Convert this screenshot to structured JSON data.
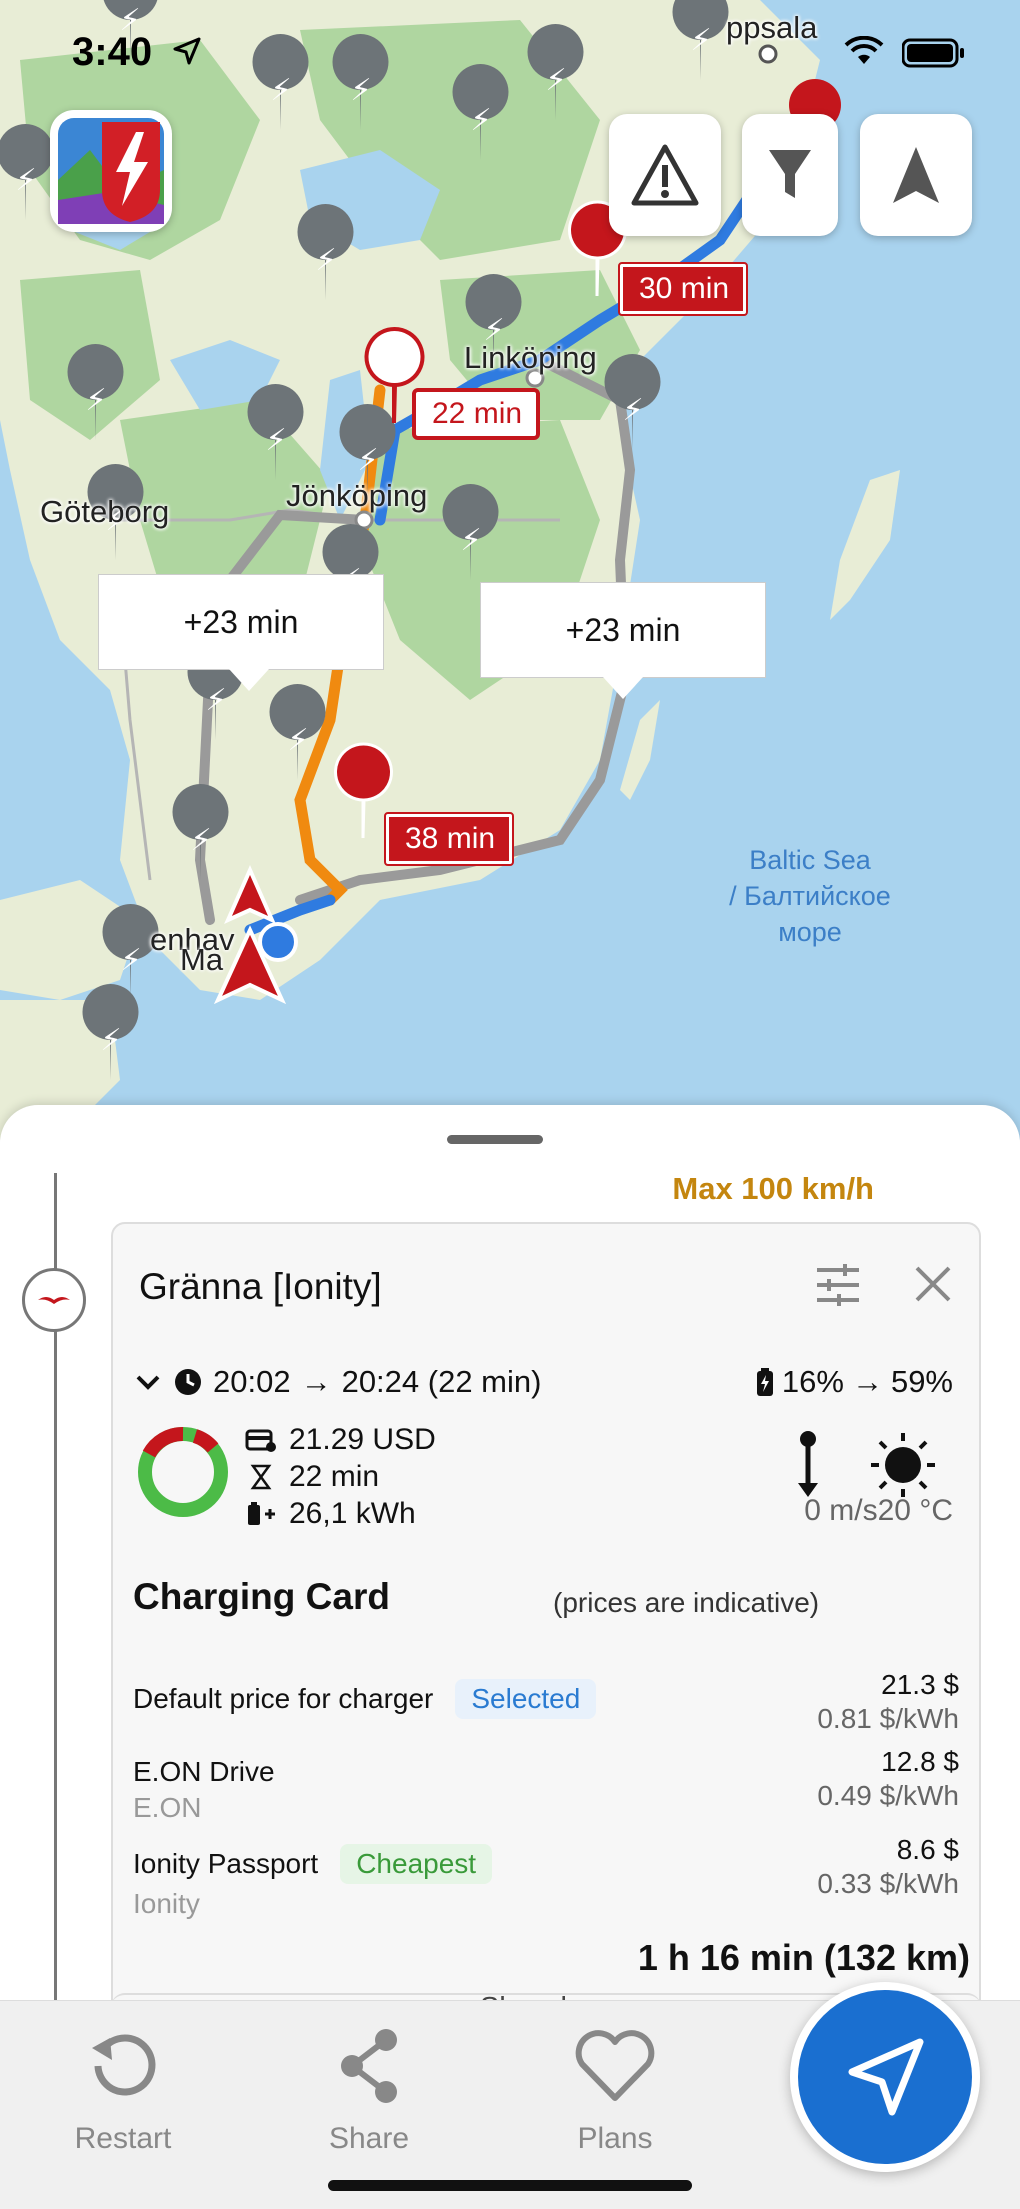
{
  "status_bar": {
    "time": "3:40"
  },
  "map": {
    "labels": {
      "uppsala": "ppsala",
      "linkoping": "Linköping",
      "jonkoping": "Jönköping",
      "goteborg": "Göteborg",
      "kopenhamn": "enhav",
      "malmo": "Ma",
      "sea_line1": "Baltic Sea",
      "sea_line2": "/ Балтийское",
      "sea_line3": "море"
    },
    "charge_stop_flags": [
      "30 min",
      "22 min",
      "38 min"
    ],
    "route_callouts": [
      "+23 min",
      "+23 min"
    ],
    "buttons": [
      "warning-icon",
      "filter-icon",
      "navigation-arrow-icon"
    ],
    "colors": {
      "route_primary": "#2f7be0",
      "route_alternative": "#f08a10",
      "route_other": "#9a9a9a",
      "stop_flag": "#c4161c",
      "sea": "#a9d3ee",
      "land": "#e9edd8",
      "forest": "#9fcf8f"
    }
  },
  "sheet": {
    "speed_limit": "Max 100 km/h",
    "stop": {
      "title": "Gränna [Ionity]",
      "arrival": "20:02",
      "departure": "20:24 (22 min)",
      "soc_from": "16%",
      "soc_to": "59%",
      "cost": "21.29 USD",
      "duration": "22 min",
      "energy": "26,1 kWh",
      "wind": "0 m/s",
      "temperature": "20 °C",
      "charging_card_title": "Charging Card",
      "prices_note": "(prices are indicative)",
      "prices": [
        {
          "name": "Default price for charger",
          "provider": "",
          "badge": "Selected",
          "price": "21.3 $",
          "per_kwh": "0.81 $/kWh"
        },
        {
          "name": "E.ON Drive",
          "provider": "E.ON",
          "badge": "",
          "price": "12.8 $",
          "per_kwh": "0.49 $/kWh"
        },
        {
          "name": "Ionity Passport",
          "provider": "Ionity",
          "badge": "Cheapest",
          "price": "8.6 $",
          "per_kwh": "0.33 $/kWh"
        }
      ],
      "show_less": "Show less"
    },
    "leg_total": "1 h 16 min (132 km)"
  },
  "tab_bar": {
    "restart": "Restart",
    "share": "Share",
    "plans": "Plans"
  }
}
